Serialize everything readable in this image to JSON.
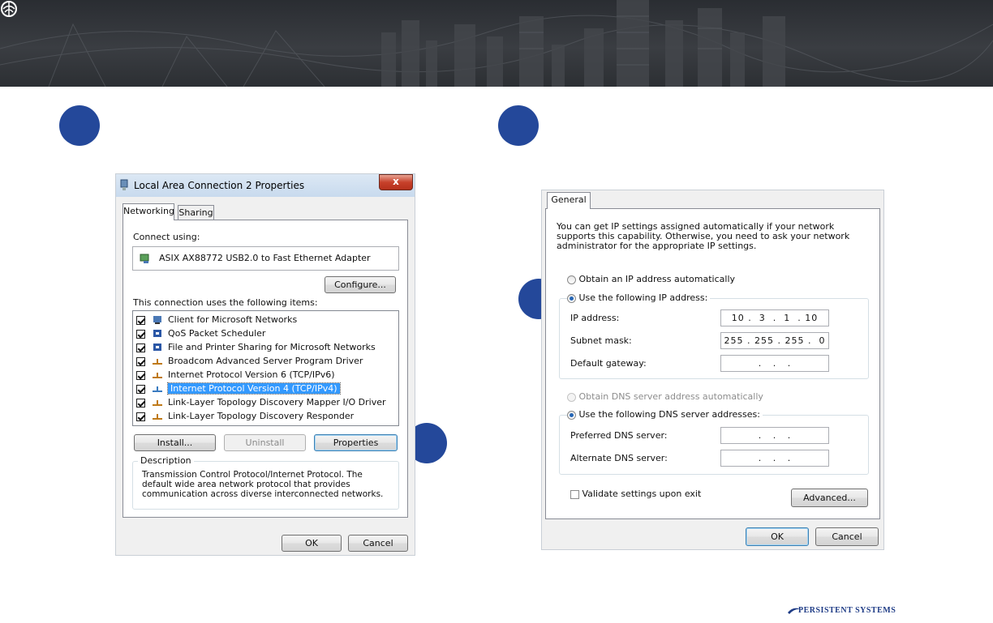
{
  "left_dialog": {
    "title": "Local Area Connection 2 Properties",
    "close_glyph": "x",
    "tabs": [
      "Networking",
      "Sharing"
    ],
    "connect_using_label": "Connect using:",
    "adapter_name": "ASIX AX88772 USB2.0 to Fast Ethernet Adapter",
    "configure_button": "Configure...",
    "items_label": "This connection uses the following items:",
    "items": [
      {
        "label": "Client for Microsoft Networks",
        "checked": true,
        "icon": "network-client-icon"
      },
      {
        "label": "QoS Packet Scheduler",
        "checked": true,
        "icon": "network-service-icon"
      },
      {
        "label": "File and Printer Sharing for Microsoft Networks",
        "checked": true,
        "icon": "network-service-icon"
      },
      {
        "label": "Broadcom Advanced Server Program Driver",
        "checked": true,
        "icon": "protocol-icon"
      },
      {
        "label": "Internet Protocol Version 6 (TCP/IPv6)",
        "checked": true,
        "icon": "protocol-icon"
      },
      {
        "label": "Internet Protocol Version 4 (TCP/IPv4)",
        "checked": true,
        "icon": "protocol-icon",
        "selected": true
      },
      {
        "label": "Link-Layer Topology Discovery Mapper I/O Driver",
        "checked": true,
        "icon": "protocol-icon"
      },
      {
        "label": "Link-Layer Topology Discovery Responder",
        "checked": true,
        "icon": "protocol-icon"
      }
    ],
    "install_button": "Install...",
    "uninstall_button": "Uninstall",
    "properties_button": "Properties",
    "description_label": "Description",
    "description_text": "Transmission Control Protocol/Internet Protocol. The default wide area network protocol that provides communication across diverse interconnected networks.",
    "ok_button": "OK",
    "cancel_button": "Cancel"
  },
  "right_dialog": {
    "tab": "General",
    "intro_text": "You can get IP settings assigned automatically if your network supports this capability. Otherwise, you need to ask your network administrator for the appropriate IP settings.",
    "obtain_ip_auto": "Obtain an IP address automatically",
    "use_following_ip": "Use the following IP address:",
    "ip_address_label": "IP address:",
    "ip_address_value": "10 .  3  .  1  . 10",
    "subnet_mask_label": "Subnet mask:",
    "subnet_mask_value": "255 . 255 . 255 .  0",
    "default_gateway_label": "Default gateway:",
    "default_gateway_value": " .   .   . ",
    "obtain_dns_auto": "Obtain DNS server address automatically",
    "use_following_dns": "Use the following DNS server addresses:",
    "preferred_dns_label": "Preferred DNS server:",
    "preferred_dns_value": " .   .   . ",
    "alternate_dns_label": "Alternate DNS server:",
    "alternate_dns_value": " .   .   . ",
    "validate_label": "Validate settings upon exit",
    "advanced_button": "Advanced...",
    "ok_button": "OK",
    "cancel_button": "Cancel"
  },
  "footer": {
    "brand": "PERSISTENT SYSTEMS"
  },
  "colors": {
    "step_circle": "#24489a",
    "selection": "#3399ff",
    "banner": "#32353a"
  }
}
